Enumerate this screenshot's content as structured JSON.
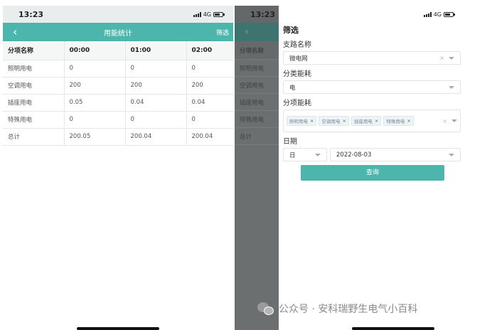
{
  "left": {
    "status": {
      "time": "13:23",
      "network": "4G"
    },
    "nav": {
      "back_icon": "chevron-left-icon",
      "back_glyph": "‹",
      "title": "用能统计",
      "filter_label": "筛选"
    },
    "table": {
      "headers": [
        "分项名称",
        "00:00",
        "01:00",
        "02:00"
      ],
      "rows": [
        [
          "照明用电",
          "0",
          "0",
          "0"
        ],
        [
          "空调用电",
          "200",
          "200",
          "200"
        ],
        [
          "插座用电",
          "0.05",
          "0.04",
          "0.04"
        ],
        [
          "特殊用电",
          "0",
          "0",
          "0"
        ],
        [
          "总计",
          "200.05",
          "200.04",
          "200.04"
        ]
      ]
    }
  },
  "right": {
    "overlay": {
      "time": "13:23",
      "back_glyph": "‹",
      "rows": [
        "分项名称",
        "照明用电",
        "空调用电",
        "插座用电",
        "特殊用电",
        "总计"
      ]
    },
    "status": {
      "network": "4G"
    },
    "drawer": {
      "title": "筛选",
      "branch_label": "支路名称",
      "branch_value": "微电网",
      "category_label": "分类能耗",
      "category_value": "电",
      "item_label": "分项能耗",
      "item_tags": [
        "照明用电",
        "空调用电",
        "插座用电",
        "特殊用电"
      ],
      "tag_remove_glyph": "×",
      "clear_glyph": "×",
      "date_label": "日期",
      "date_unit": "日",
      "date_value": "2022-08-03",
      "query_label": "查询"
    }
  },
  "watermark": {
    "text": "公众号 · 安科瑞野生电气小百科"
  },
  "colors": {
    "accent": "#4db6ac",
    "overlay": "#6b6f6f"
  }
}
